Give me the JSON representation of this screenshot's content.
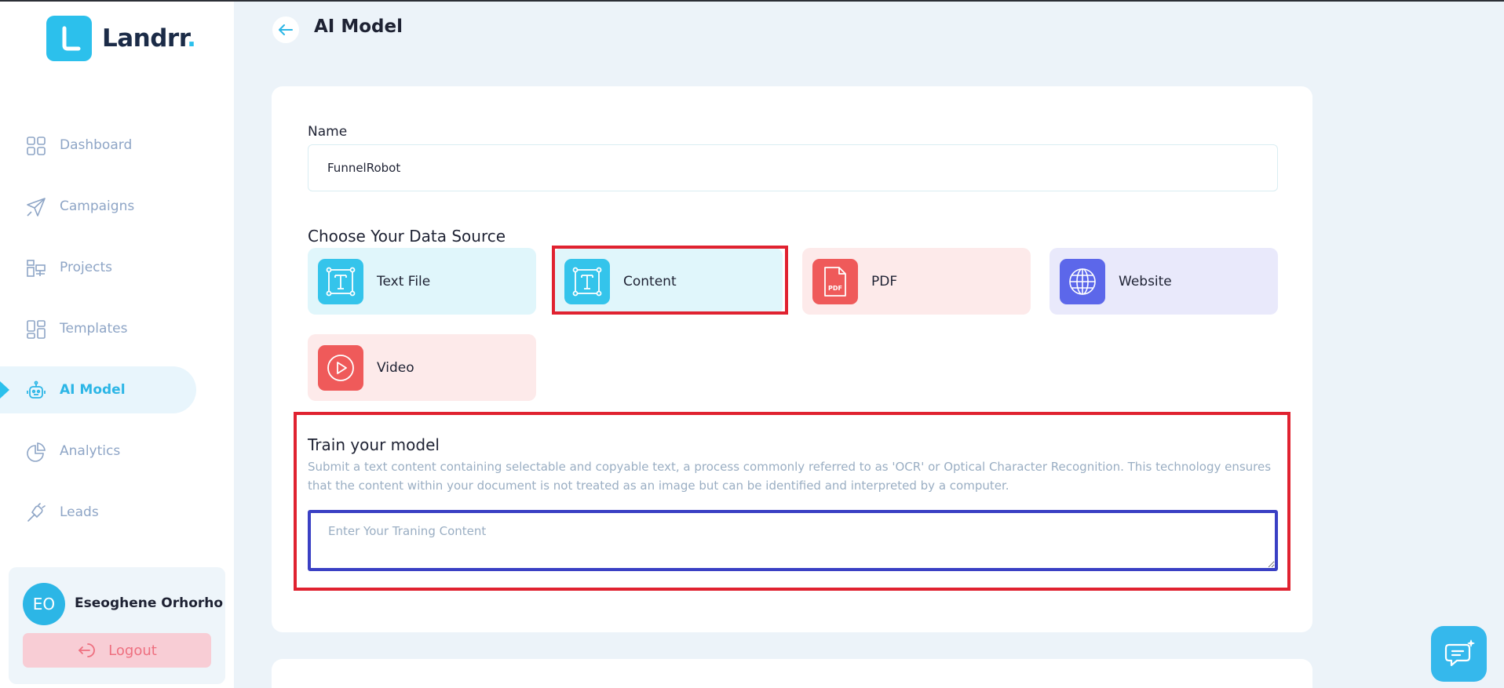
{
  "brand": {
    "name": "Landrr",
    "dot": ".",
    "color": "#2cc0ec"
  },
  "sidebar": {
    "items": [
      {
        "label": "Dashboard",
        "icon": "grid-icon"
      },
      {
        "label": "Campaigns",
        "icon": "paper-plane-icon"
      },
      {
        "label": "Projects",
        "icon": "projects-icon"
      },
      {
        "label": "Templates",
        "icon": "templates-icon"
      },
      {
        "label": "AI Model",
        "icon": "robot-icon",
        "active": true
      },
      {
        "label": "Analytics",
        "icon": "pie-chart-icon"
      },
      {
        "label": "Leads",
        "icon": "leads-icon"
      }
    ]
  },
  "user": {
    "initials": "EO",
    "name": "Eseoghene Orhorho",
    "logout_label": "Logout"
  },
  "header": {
    "title": "AI Model"
  },
  "form": {
    "name_label": "Name",
    "name_value": "FunnelRobot",
    "data_source_heading": "Choose Your Data Source",
    "sources": [
      {
        "label": "Text File",
        "icon": "text-icon"
      },
      {
        "label": "Content",
        "icon": "text-icon",
        "selected": true
      },
      {
        "label": "PDF",
        "icon": "pdf-icon",
        "badge": "PDF"
      },
      {
        "label": "Website",
        "icon": "globe-icon"
      },
      {
        "label": "Video",
        "icon": "play-icon"
      }
    ],
    "train": {
      "title": "Train your model",
      "description": "Submit a text content containing selectable and copyable text, a process commonly referred to as 'OCR' or Optical Character Recognition. This technology ensures that the content within your document is not treated as an image but can be identified and interpreted by a computer.",
      "placeholder": "Enter Your Traning Content"
    }
  },
  "colors": {
    "accent": "#2cc0ec",
    "highlight": "#e02230",
    "focus": "#3a40c4"
  }
}
